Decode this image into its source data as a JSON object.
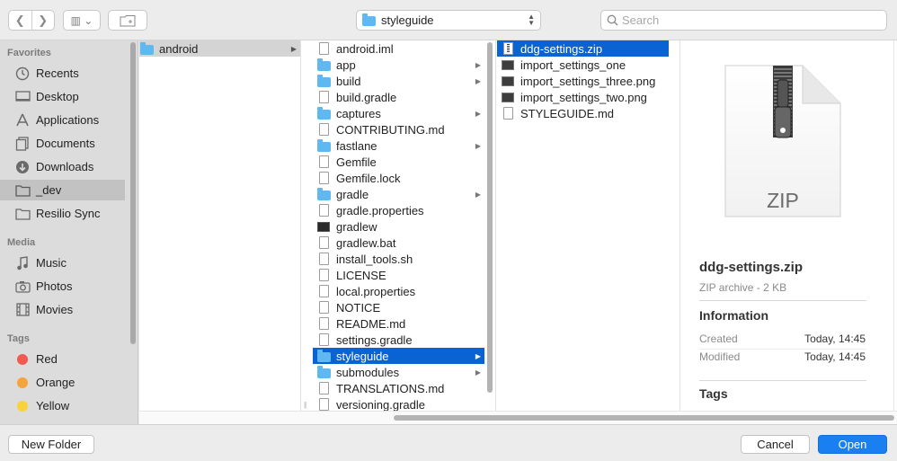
{
  "toolbar": {
    "location_label": "styleguide",
    "search_placeholder": "Search",
    "back_glyph": "❮",
    "forward_glyph": "❯",
    "view_glyph": "▥ ⌄"
  },
  "sidebar": {
    "favorites_title": "Favorites",
    "favorites": [
      {
        "label": "Recents",
        "icon": "clock-icon"
      },
      {
        "label": "Desktop",
        "icon": "desktop-icon"
      },
      {
        "label": "Applications",
        "icon": "applications-icon"
      },
      {
        "label": "Documents",
        "icon": "documents-icon"
      },
      {
        "label": "Downloads",
        "icon": "downloads-icon"
      },
      {
        "label": "_dev",
        "icon": "folder-icon"
      },
      {
        "label": "Resilio Sync",
        "icon": "folder-icon"
      }
    ],
    "media_title": "Media",
    "media": [
      {
        "label": "Music",
        "icon": "music-icon"
      },
      {
        "label": "Photos",
        "icon": "camera-icon"
      },
      {
        "label": "Movies",
        "icon": "film-icon"
      }
    ],
    "tags_title": "Tags",
    "tags": [
      {
        "label": "Red",
        "color": "#f25a51"
      },
      {
        "label": "Orange",
        "color": "#f5a33b"
      },
      {
        "label": "Yellow",
        "color": "#f7d23a"
      }
    ]
  },
  "columns": {
    "col1": [
      {
        "label": "android",
        "kind": "folder",
        "has_children": true
      }
    ],
    "col2": [
      {
        "label": "android.iml",
        "kind": "doc"
      },
      {
        "label": "app",
        "kind": "folder",
        "has_children": true
      },
      {
        "label": "build",
        "kind": "folder",
        "has_children": true
      },
      {
        "label": "build.gradle",
        "kind": "doc"
      },
      {
        "label": "captures",
        "kind": "folder",
        "has_children": true
      },
      {
        "label": "CONTRIBUTING.md",
        "kind": "doc"
      },
      {
        "label": "fastlane",
        "kind": "folder",
        "has_children": true
      },
      {
        "label": "Gemfile",
        "kind": "doc"
      },
      {
        "label": "Gemfile.lock",
        "kind": "doc"
      },
      {
        "label": "gradle",
        "kind": "folder",
        "has_children": true
      },
      {
        "label": "gradle.properties",
        "kind": "doc"
      },
      {
        "label": "gradlew",
        "kind": "terminal"
      },
      {
        "label": "gradlew.bat",
        "kind": "doc"
      },
      {
        "label": "install_tools.sh",
        "kind": "doc"
      },
      {
        "label": "LICENSE",
        "kind": "doc"
      },
      {
        "label": "local.properties",
        "kind": "doc"
      },
      {
        "label": "NOTICE",
        "kind": "doc"
      },
      {
        "label": "README.md",
        "kind": "doc"
      },
      {
        "label": "settings.gradle",
        "kind": "doc"
      },
      {
        "label": "styleguide",
        "kind": "folder",
        "has_children": true,
        "selected": true
      },
      {
        "label": "submodules",
        "kind": "folder",
        "has_children": true
      },
      {
        "label": "TRANSLATIONS.md",
        "kind": "doc"
      },
      {
        "label": "versioning.gradle",
        "kind": "doc"
      }
    ],
    "col3": [
      {
        "label": "ddg-settings.zip",
        "kind": "zip",
        "selected": true
      },
      {
        "label": "import_settings_one",
        "kind": "image"
      },
      {
        "label": "import_settings_three.png",
        "kind": "image"
      },
      {
        "label": "import_settings_two.png",
        "kind": "image"
      },
      {
        "label": "STYLEGUIDE.md",
        "kind": "doc"
      }
    ]
  },
  "preview": {
    "icon_label": "ZIP",
    "name": "ddg-settings.zip",
    "kind": "ZIP archive - 2 KB",
    "info_title": "Information",
    "created_label": "Created",
    "created_value": "Today, 14:45",
    "modified_label": "Modified",
    "modified_value": "Today, 14:45",
    "tags_title": "Tags"
  },
  "footer": {
    "new_folder_label": "New Folder",
    "cancel_label": "Cancel",
    "open_label": "Open"
  }
}
